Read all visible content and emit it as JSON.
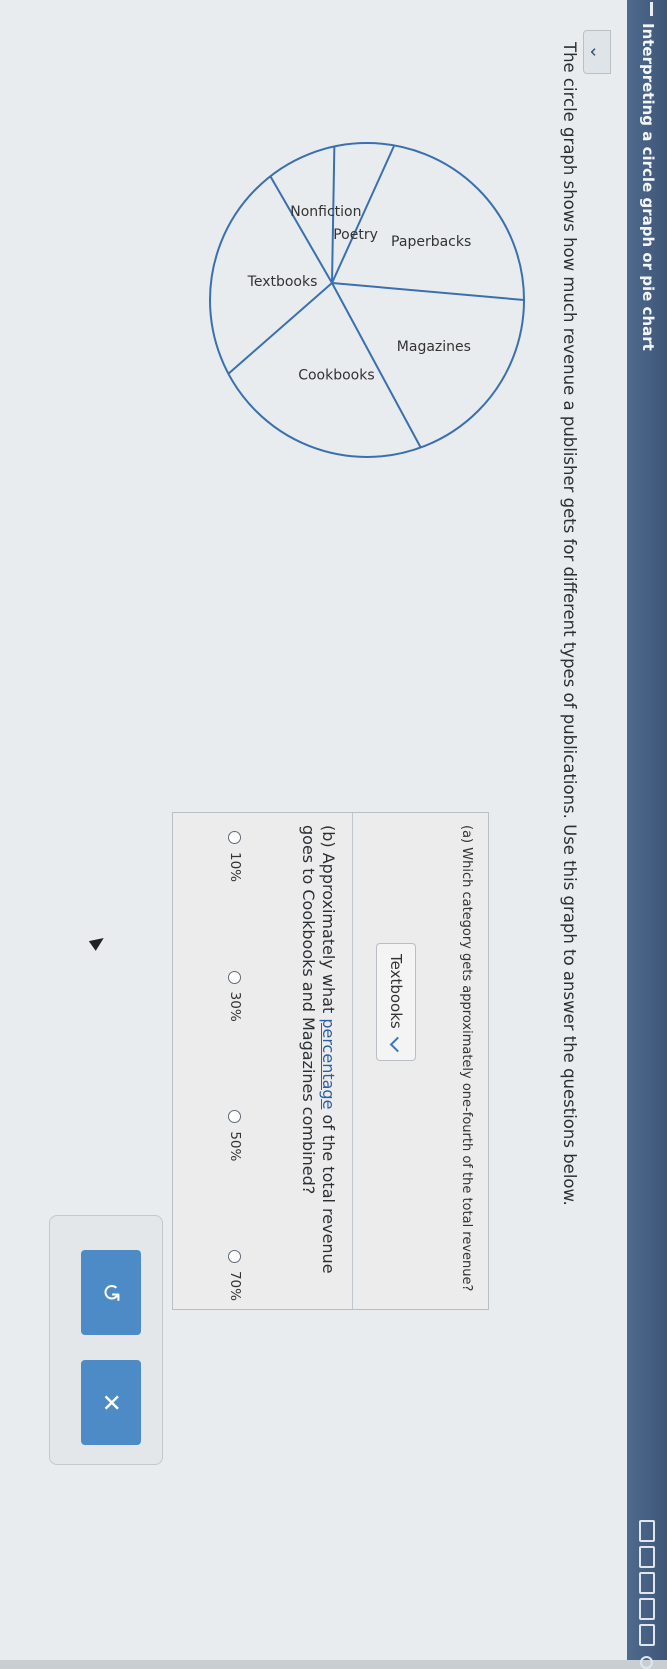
{
  "header": {
    "title": "Interpreting a circle graph or pie chart"
  },
  "collapse_icon": "chevron-down-icon",
  "prompt": "The circle graph shows how much revenue a publisher gets for different types of publications. Use this graph to answer the questions below.",
  "chart_data": {
    "type": "pie",
    "slices": [
      {
        "label": "Paperbacks",
        "value": 15
      },
      {
        "label": "Magazines",
        "value": 20
      },
      {
        "label": "Cookbooks",
        "value": 25
      },
      {
        "label": "Textbooks",
        "value": 25
      },
      {
        "label": "Nonfiction",
        "value": 10
      },
      {
        "label": "Poetry",
        "value": 5
      }
    ]
  },
  "question_a": {
    "text": "(a) Which category gets approximately one-fourth of the total revenue?",
    "selected": "Textbooks"
  },
  "question_b": {
    "text_pre": "(b) Approximately what ",
    "link": "percentage",
    "text_post": " of the total revenue goes to Cookbooks and Magazines combined?",
    "options": [
      "10%",
      "30%",
      "50%",
      "70%"
    ]
  },
  "buttons": {
    "undo_icon": "undo-icon",
    "clear_icon": "close-icon",
    "undo": "↺",
    "clear": "✕"
  }
}
